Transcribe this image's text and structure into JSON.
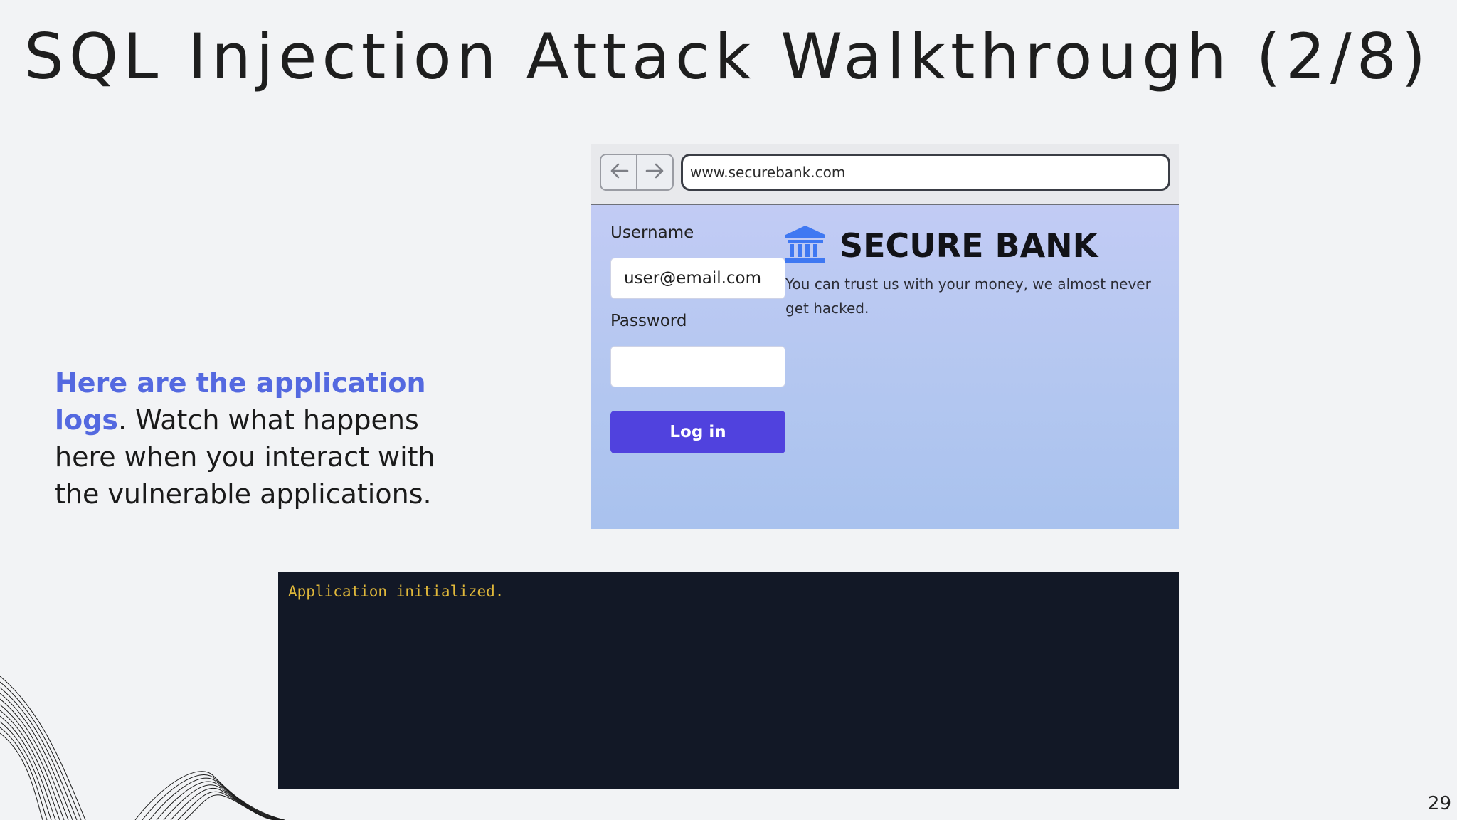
{
  "slide": {
    "title": "SQL Injection Attack Walkthrough (2/8)",
    "page_number": "29"
  },
  "intro": {
    "highlight": "Here are the application logs",
    "rest": ". Watch what happens here when you interact with the vulnerable applications."
  },
  "browser": {
    "back_icon": "arrow-left-icon",
    "forward_icon": "arrow-right-icon",
    "url": "www.securebank.com"
  },
  "login_form": {
    "username_label": "Username",
    "username_value": "user@email.com",
    "password_label": "Password",
    "password_value": "",
    "submit_label": "Log in"
  },
  "bank": {
    "icon": "bank-building-icon",
    "name": "SECURE BANK",
    "tagline": "You can trust us with your money, we almost never get hacked."
  },
  "logs": {
    "lines": [
      "Application initialized."
    ]
  },
  "colors": {
    "accent": "#5469e0",
    "button": "#5042de",
    "log_bg": "#121826",
    "log_text": "#e0b83a"
  }
}
